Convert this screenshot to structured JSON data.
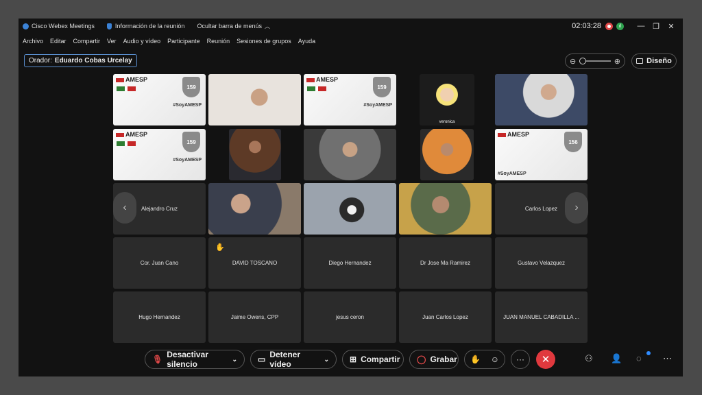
{
  "titlebar": {
    "app_name": "Cisco Webex Meetings",
    "meeting_info": "Información de la reunión",
    "hide_menu": "Ocultar barra de menús",
    "timer": "02:03:28"
  },
  "menu": [
    "Archivo",
    "Editar",
    "Compartir",
    "Ver",
    "Audio y vídeo",
    "Participante",
    "Reunión",
    "Sesiones de grupos",
    "Ayuda"
  ],
  "speaker": {
    "label": "Orador:",
    "name": "Eduardo Cobas Urcelay"
  },
  "layout_label": "Diseño",
  "slide": {
    "brand": "AMESP",
    "badge_a": "159",
    "badge_b": "156",
    "hashtag": "#SoyAMESP"
  },
  "video_labels": {
    "veronica": "veronica"
  },
  "participants": {
    "row3": [
      "Alejandro Cruz",
      "Carlos Lopez"
    ],
    "row4": [
      "Cor. Juan Cano",
      "DAVID TOSCANO",
      "Diego Hernandez",
      "Dr Jose Ma Ramirez",
      "Gustavo Velazquez"
    ],
    "row5": [
      "Hugo Hernandez",
      "Jaime Owens, CPP",
      "jesus ceron",
      "Juan Carlos Lopez",
      "JUAN MANUEL CABADILLA ..."
    ]
  },
  "controls": {
    "mute": "Desactivar silencio",
    "video": "Detener vídeo",
    "share": "Compartir",
    "record": "Grabar",
    "more": "···"
  },
  "icons": {
    "hand": "raised-hand-icon"
  }
}
